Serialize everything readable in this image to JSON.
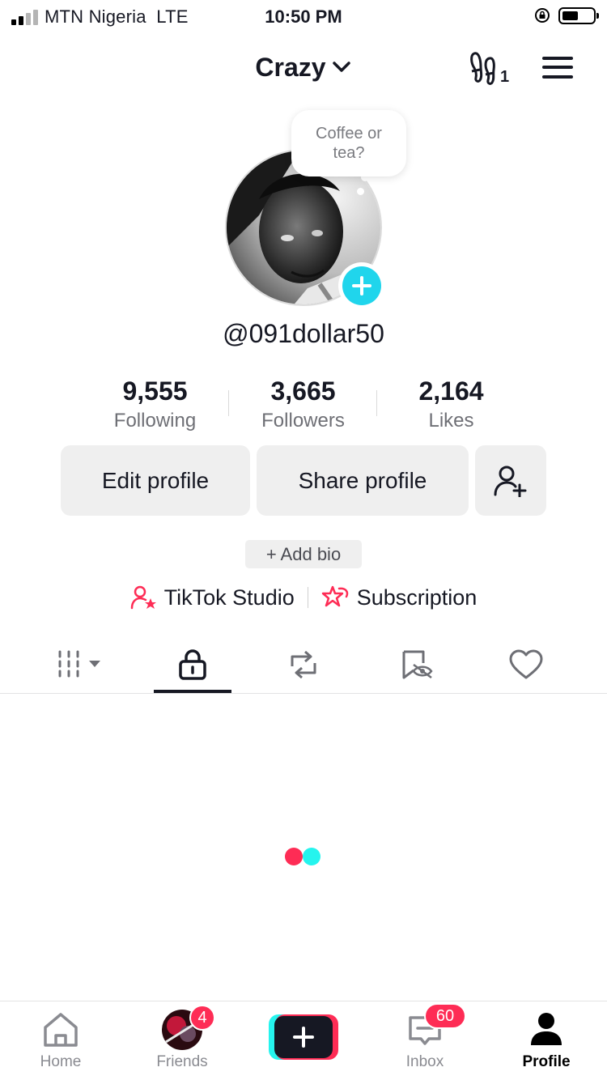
{
  "status_bar": {
    "carrier": "MTN Nigeria",
    "network": "LTE",
    "time": "10:50 PM"
  },
  "header": {
    "account_name": "Crazy",
    "footprint_count": "1"
  },
  "profile": {
    "note_bubble": "Coffee or tea?",
    "username": "@091dollar50"
  },
  "stats": [
    {
      "value": "9,555",
      "label": "Following"
    },
    {
      "value": "3,665",
      "label": "Followers"
    },
    {
      "value": "2,164",
      "label": "Likes"
    }
  ],
  "actions": {
    "edit_profile": "Edit profile",
    "share_profile": "Share profile",
    "add_bio": "+ Add bio"
  },
  "links": {
    "studio": "TikTok Studio",
    "subscription": "Subscription"
  },
  "tabs": [
    "videos-grid",
    "private",
    "reposts",
    "favorites",
    "liked"
  ],
  "bottom_nav": {
    "home": "Home",
    "friends": "Friends",
    "friends_badge": "4",
    "inbox": "Inbox",
    "inbox_badge": "60",
    "profile": "Profile"
  },
  "colors": {
    "accent_red": "#fe2c55",
    "accent_cyan": "#25f4ee",
    "avatar_add_blue": "#20d5ec",
    "text_primary": "#161823"
  }
}
